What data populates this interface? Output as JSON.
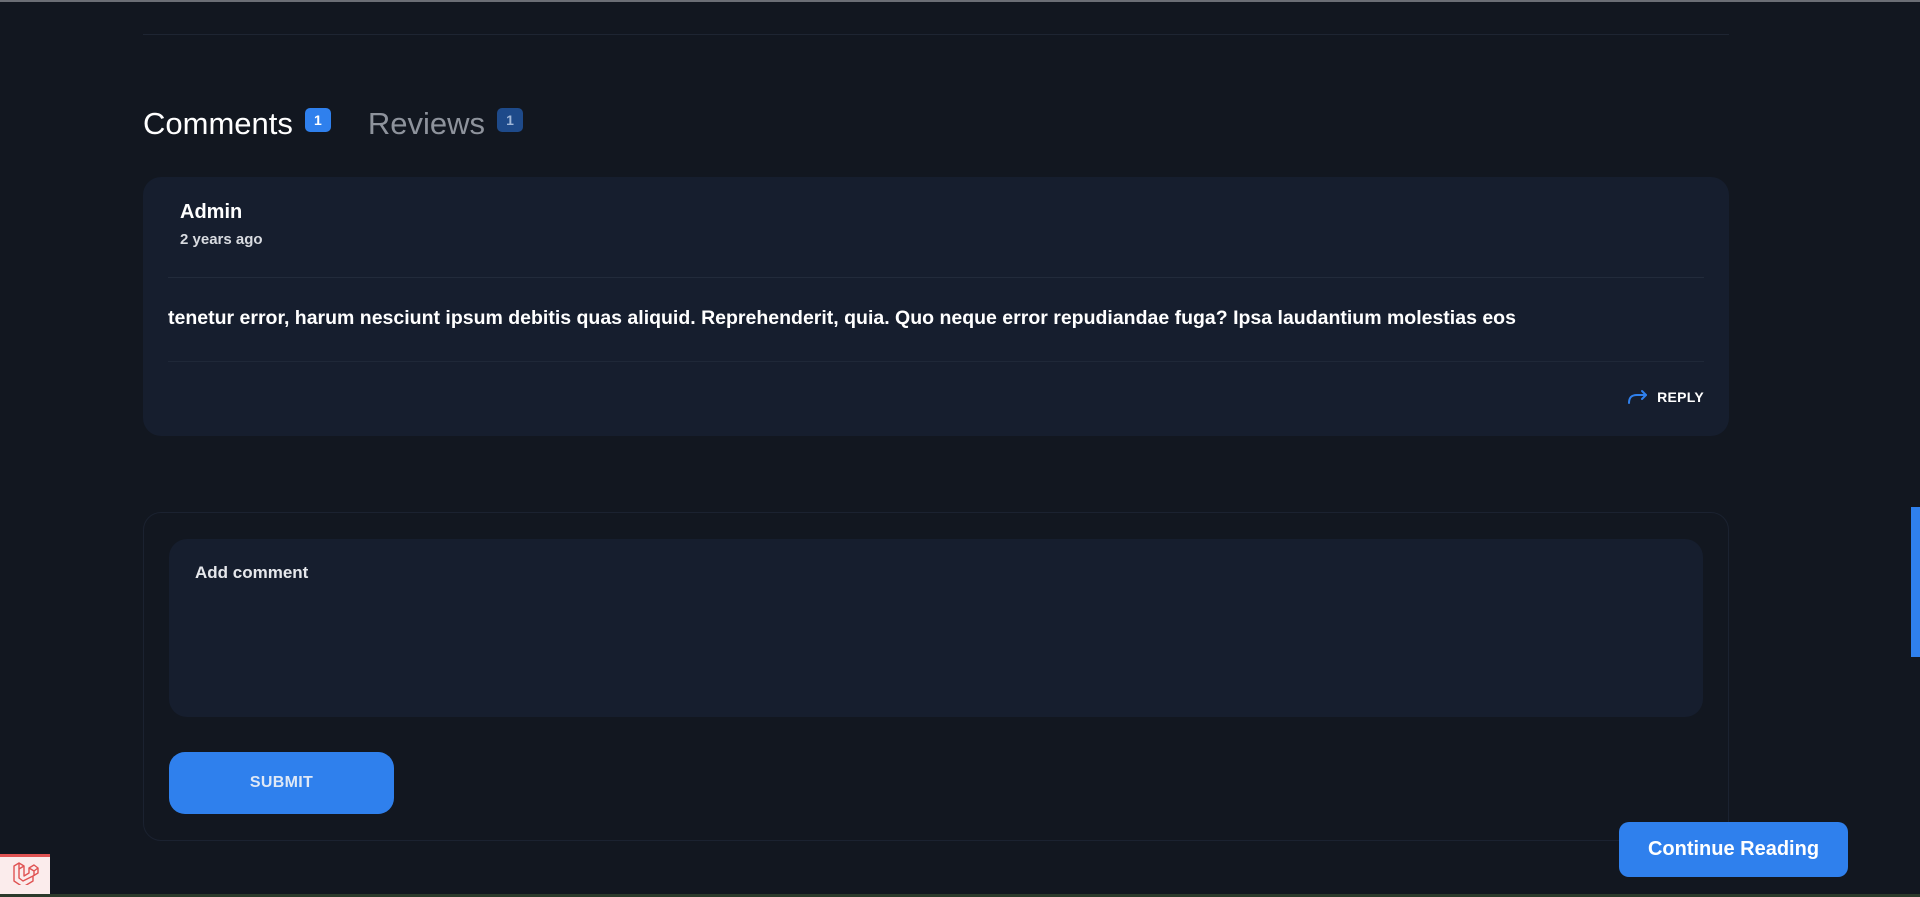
{
  "tabs": [
    {
      "label": "Comments",
      "count": "1",
      "active": true
    },
    {
      "label": "Reviews",
      "count": "1",
      "active": false
    }
  ],
  "comment": {
    "author": "Admin",
    "time": "2 years ago",
    "body": "tenetur error, harum nesciunt ipsum debitis quas aliquid. Reprehenderit, quia. Quo neque error repudiandae fuga? Ipsa laudantium molestias eos",
    "reply_label": "REPLY",
    "reply_icon": "reply-arrow-icon"
  },
  "form": {
    "placeholder": "Add comment",
    "submit_label": "SUBMIT"
  },
  "floating": {
    "continue_label": "Continue Reading"
  },
  "debug_bar": {
    "icon": "laravel-logo-icon"
  },
  "colors": {
    "background": "#121720",
    "card": "#161e2e",
    "accent": "#2f80ed"
  }
}
